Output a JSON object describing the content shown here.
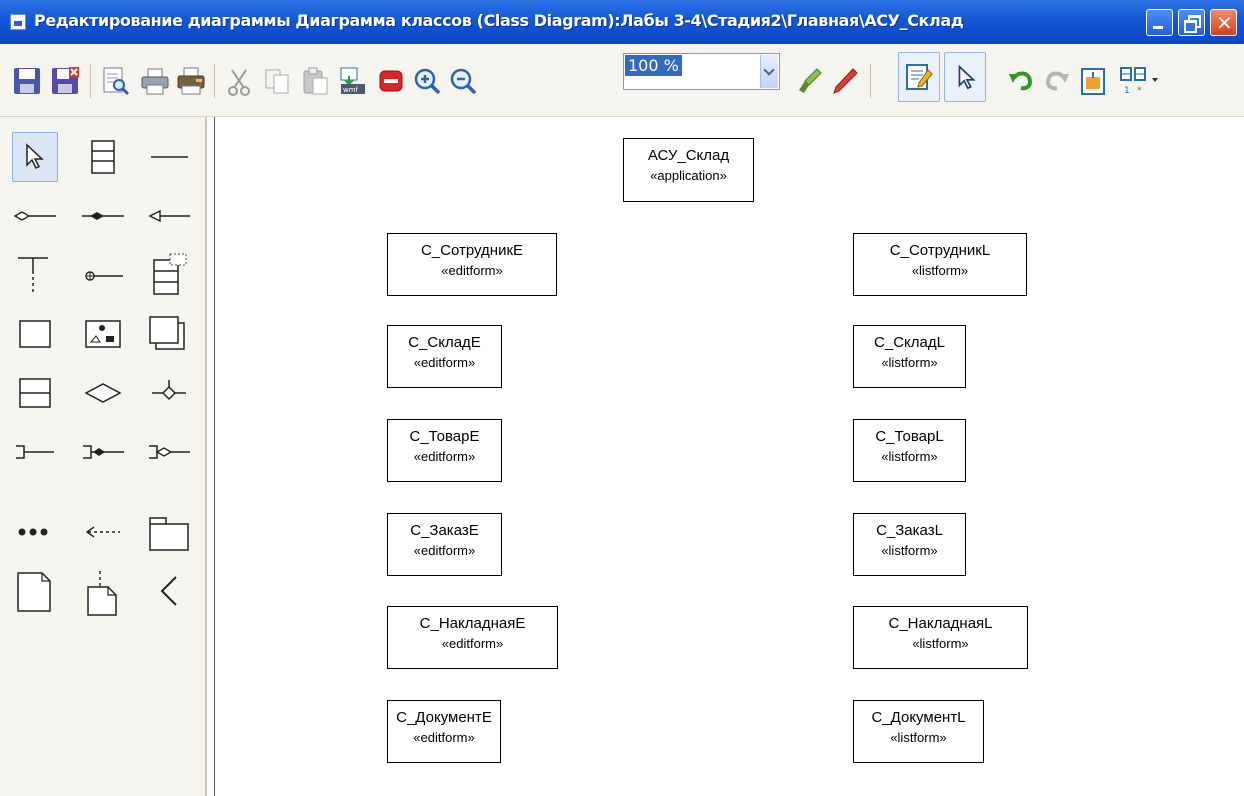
{
  "window": {
    "title": "Редактирование диаграммы Диаграмма классов (Class Diagram):Лабы 3-4\\Стадия2\\Главная\\АСУ_Склад"
  },
  "toolbar": {
    "zoom_value": "100 %"
  },
  "diagram": {
    "app_class": {
      "name": "АСУ_Склад",
      "stereotype": "«application»"
    },
    "edit_classes": [
      {
        "name": "С_СотрудникE",
        "stereotype": "«editform»"
      },
      {
        "name": "С_СкладE",
        "stereotype": "«editform»"
      },
      {
        "name": "С_ТоварE",
        "stereotype": "«editform»"
      },
      {
        "name": "С_ЗаказE",
        "stereotype": "«editform»"
      },
      {
        "name": "С_НакладнаяE",
        "stereotype": "«editform»"
      },
      {
        "name": "С_ДокументE",
        "stereotype": "«editform»"
      }
    ],
    "list_classes": [
      {
        "name": "С_СотрудникL",
        "stereotype": "«listform»"
      },
      {
        "name": "С_СкладL",
        "stereotype": "«listform»"
      },
      {
        "name": "С_ТоварL",
        "stereotype": "«listform»"
      },
      {
        "name": "С_ЗаказL",
        "stereotype": "«listform»"
      },
      {
        "name": "С_НакладнаяL",
        "stereotype": "«listform»"
      },
      {
        "name": "С_ДокументL",
        "stereotype": "«listform»"
      }
    ]
  }
}
